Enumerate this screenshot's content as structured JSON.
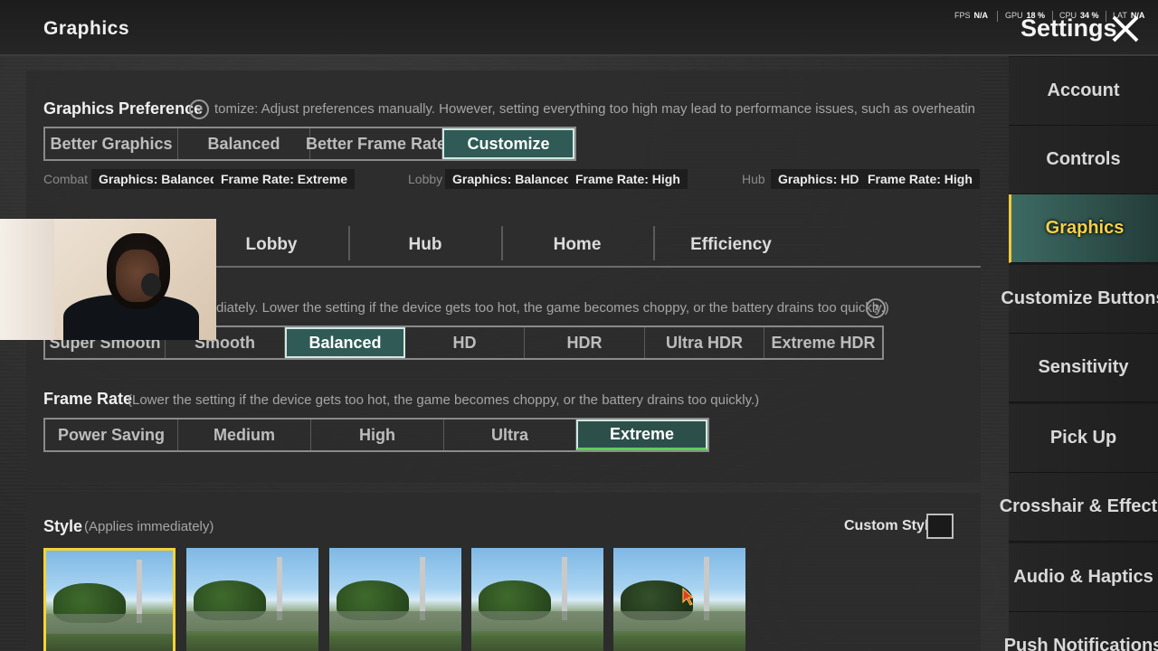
{
  "header": {
    "page_title": "Graphics",
    "settings_title": "Settings",
    "perf": [
      {
        "label": "FPS",
        "value": "N/A"
      },
      {
        "label": "GPU",
        "value": "18 %"
      },
      {
        "label": "CPU",
        "value": "34 %"
      },
      {
        "label": "LAT",
        "value": "N/A"
      }
    ]
  },
  "sidebar": {
    "items": [
      {
        "label": "Account"
      },
      {
        "label": "Controls"
      },
      {
        "label": "Graphics",
        "active": true
      },
      {
        "label": "Customize Buttons"
      },
      {
        "label": "Sensitivity"
      },
      {
        "label": "Pick Up"
      },
      {
        "label": "Crosshair & Effects"
      },
      {
        "label": "Audio & Haptics"
      },
      {
        "label": "Push Notifications"
      }
    ]
  },
  "graphics_preference": {
    "label": "Graphics Preference",
    "description": "tomize: Adjust preferences manually. However, setting everything too high may lead to performance issues, such as overheating,",
    "options": [
      "Better Graphics",
      "Balanced",
      "Better Frame Rate",
      "Customize"
    ],
    "selected": "Customize",
    "presets": [
      {
        "label": "Combat",
        "graphics": "Graphics: Balanced",
        "frame_rate": "Frame Rate: Extreme"
      },
      {
        "label": "Lobby",
        "graphics": "Graphics: Balanced",
        "frame_rate": "Frame Rate: High"
      },
      {
        "label": "Hub",
        "graphics": "Graphics: HD",
        "frame_rate": "Frame Rate: High"
      }
    ]
  },
  "mode_tabs": [
    "Lobby",
    "Hub",
    "Home",
    "Efficiency"
  ],
  "graphics_quality": {
    "description": "diately. Lower the setting if the device gets too hot, the game becomes choppy, or the battery drains too quickly.)",
    "options": [
      "Super Smooth",
      "Smooth",
      "Balanced",
      "HD",
      "HDR",
      "Ultra HDR",
      "Extreme HDR"
    ],
    "selected": "Balanced"
  },
  "frame_rate": {
    "label": "Frame Rate",
    "description": "(Lower the setting if the device gets too hot, the game becomes choppy, or the battery drains too quickly.)",
    "options": [
      "Power Saving",
      "Medium",
      "High",
      "Ultra",
      "Extreme"
    ],
    "selected": "Extreme"
  },
  "style": {
    "label": "Style",
    "description": "(Applies immediately)",
    "custom_style_label": "Custom Style",
    "custom_style_checked": false,
    "thumbnail_count": 5,
    "selected_index": 0
  },
  "colors": {
    "accent_selected": "#2f5a55",
    "active_nav_text": "#f5d24a",
    "selected_frame": "#f2d43a"
  }
}
